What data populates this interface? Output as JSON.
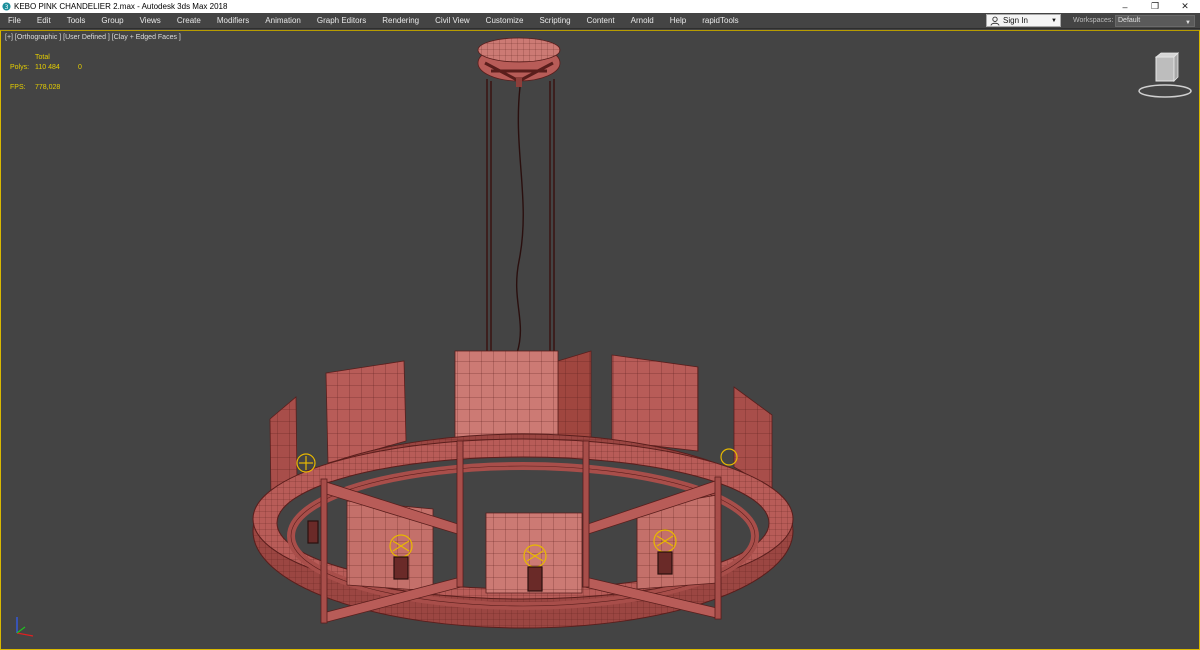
{
  "window": {
    "title": "KEBO PINK CHANDELIER 2.max - Autodesk 3ds Max 2018",
    "minimize_glyph": "–",
    "restore_glyph": "❐",
    "close_glyph": "✕"
  },
  "menu": [
    "File",
    "Edit",
    "Tools",
    "Group",
    "Views",
    "Create",
    "Modifiers",
    "Animation",
    "Graph Editors",
    "Rendering",
    "Civil View",
    "Customize",
    "Scripting",
    "Content",
    "Arnold",
    "Help",
    "rapidTools"
  ],
  "account": {
    "signin_label": "Sign In",
    "icon": "user-icon"
  },
  "workspaces": {
    "label": "Workspaces:",
    "value": "Default"
  },
  "viewport": {
    "label": "[+] [Orthographic ] [User Defined ] [Clay + Edged Faces ]",
    "stats": {
      "total_label": "Total",
      "polys_label": "Polys:",
      "polys_value": "110 484",
      "polys_selected": "0",
      "fps_label": "FPS:",
      "fps_value": "778,028"
    }
  },
  "colors": {
    "viewport_bg": "#444444",
    "model": "#b85c58",
    "model_light": "#cc7a74",
    "model_dark": "#8e3e3a",
    "wire": "#5a1e1c",
    "stats_text": "#e6cf00",
    "bulb": "#e8b800"
  }
}
